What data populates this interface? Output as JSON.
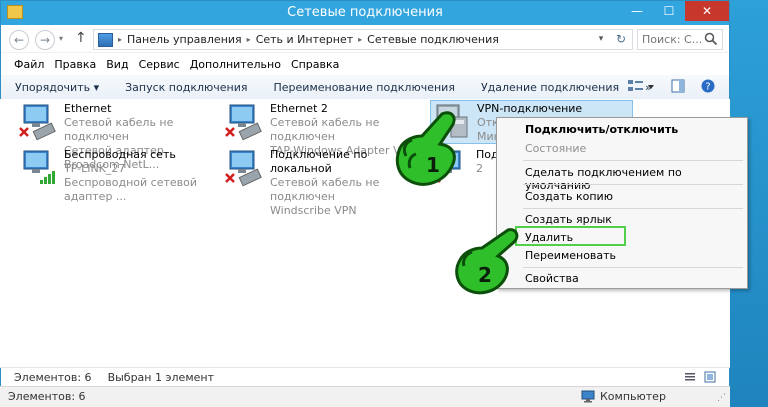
{
  "window": {
    "title": "Сетевые подключения",
    "minimize": "—",
    "maximize": "☐",
    "close": "✕"
  },
  "nav": {
    "back": "←",
    "forward": "→",
    "up": "↑"
  },
  "address": {
    "parts": [
      "Панель управления",
      "Сеть и Интернет",
      "Сетевые подключения"
    ],
    "sep": "▸"
  },
  "search": {
    "placeholder": "Поиск: С..."
  },
  "menu": [
    "Файл",
    "Правка",
    "Вид",
    "Сервис",
    "Дополнительно",
    "Справка"
  ],
  "toolbar": {
    "organize": "Упорядочить ▾",
    "start": "Запуск подключения",
    "rename": "Переименование подключения",
    "delete": "Удаление подключения",
    "more": "»"
  },
  "connections": [
    {
      "name": "Ethernet",
      "status": "Сетевой кабель не подключен",
      "adapter": "Сетевой адаптер Broadcom NetL..."
    },
    {
      "name": "Ethernet 2",
      "status": "Сетевой кабель не подключен",
      "adapter": "TAP-Windows Adapter V9"
    },
    {
      "name": "VPN-подключение",
      "status": "Откл",
      "adapter": "Мин"
    },
    {
      "name": "Беспроводная сеть",
      "status": "TP-LINK_27",
      "adapter": "Беспроводной сетевой адаптер ..."
    },
    {
      "name": "Подключение по локальной",
      "status": "Сетевой кабель не подключен",
      "adapter": "Windscribe VPN"
    },
    {
      "name": "Подк",
      "status": "2",
      "adapter": ""
    }
  ],
  "context_menu": [
    "Подключить/отключить",
    "Состояние",
    "Сделать подключением по умолчанию",
    "Создать копию",
    "Создать ярлык",
    "Удалить",
    "Переименовать",
    "Свойства"
  ],
  "markers": [
    "1",
    "2"
  ],
  "status": {
    "count": "Элементов: 6",
    "selected": "Выбран 1 элемент"
  },
  "status2": {
    "count": "Элементов: 6",
    "computer": "Компьютер"
  },
  "colors": {
    "title": "#33a5de",
    "selection": "#cde6f7",
    "highlight": "#52d04c",
    "hand": "#2fbf2a"
  }
}
